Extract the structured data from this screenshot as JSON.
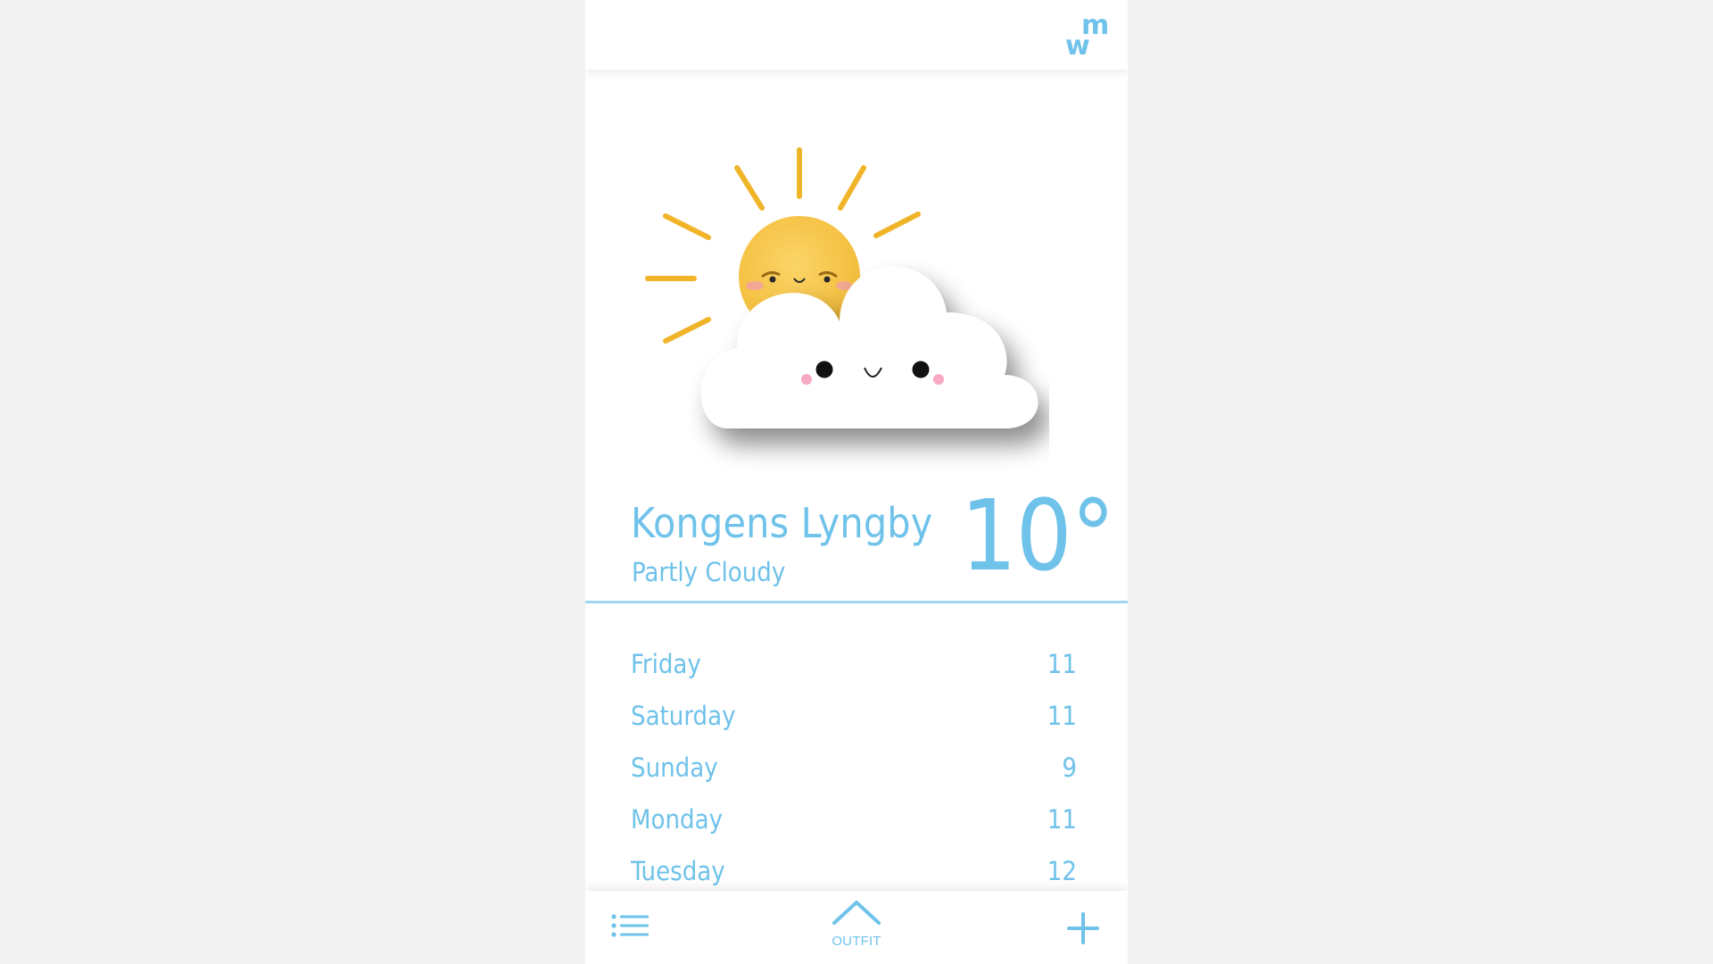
{
  "header": {
    "logo_letters": [
      "w",
      "m"
    ],
    "logo_color": "#6fc2ea"
  },
  "hero": {
    "illustration": "sun-behind-cloud-icon",
    "sun_color": "#f5c13d",
    "cloud_color": "#ffffff"
  },
  "current": {
    "city": "Kongens Lyngby",
    "condition": "Partly Cloudy",
    "temperature": "10°"
  },
  "forecast": [
    {
      "day": "Friday",
      "value": "11"
    },
    {
      "day": "Saturday",
      "value": "11"
    },
    {
      "day": "Sunday",
      "value": "9"
    },
    {
      "day": "Monday",
      "value": "11"
    },
    {
      "day": "Tuesday",
      "value": "12"
    }
  ],
  "bottom_nav": {
    "menu_icon": "list-icon",
    "outfit_label": "OUTFIT",
    "outfit_icon": "chevron-up-icon",
    "add_icon": "plus-icon"
  },
  "colors": {
    "accent": "#6fc2ea",
    "background": "#f2f2f2",
    "panel": "#ffffff"
  }
}
